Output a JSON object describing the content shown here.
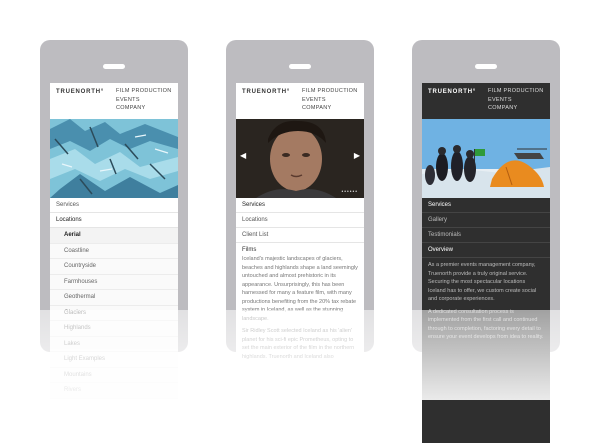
{
  "phones": [
    {
      "logo": "TRUENORTH°",
      "nav": [
        "FILM PRODUCTION",
        "EVENTS",
        "COMPANY"
      ],
      "menu": [
        {
          "label": "Services"
        },
        {
          "label": "Locations",
          "active": true
        }
      ],
      "submenu": [
        {
          "label": "Aerial",
          "active": true
        },
        {
          "label": "Coastline"
        },
        {
          "label": "Countryside"
        },
        {
          "label": "Farmhouses"
        },
        {
          "label": "Geothermal"
        },
        {
          "label": "Glaciers"
        },
        {
          "label": "Highlands"
        },
        {
          "label": "Lakes"
        },
        {
          "label": "Light Examples"
        },
        {
          "label": "Mountains"
        },
        {
          "label": "Rivers"
        }
      ]
    },
    {
      "logo": "TRUENORTH°",
      "nav": [
        "FILM PRODUCTION",
        "EVENTS",
        "COMPANY"
      ],
      "menu": [
        {
          "label": "Services",
          "active": true
        },
        {
          "label": "Locations"
        },
        {
          "label": "Client List"
        }
      ],
      "body_title": "Films",
      "body_paragraphs": [
        "Iceland's majestic landscapes of glaciers, beaches and highlands shape a land seemingly untouched and almost prehistoric in its appearance. Unsurprisingly, this has been harnessed for many a feature film, with many productions benefiting from the 20% tax rebate system in Iceland, as well as the stunning landscape.",
        "Sir Ridley Scott selected Iceland as his 'alien' planet for his sci-fi epic Prometheus, opting to set the main exterior of the film in the northern highlands. Truenorth and Iceland also"
      ]
    },
    {
      "logo": "TRUENORTH°",
      "nav": [
        "FILM PRODUCTION",
        "EVENTS",
        "COMPANY"
      ],
      "menu": [
        {
          "label": "Services",
          "active": true
        },
        {
          "label": "Gallery"
        },
        {
          "label": "Testimonials"
        }
      ],
      "body_title": "Overview",
      "body_paragraphs": [
        "As a premier events management company, Truenorth provide a truly original service. Securing the most spectacular locations Iceland has to offer, we custom create social and corporate experiences.",
        "A dedicated consultation process is implemented from the first call and continued through to completion, factoring every detail to ensure your event develops from idea to reality."
      ]
    }
  ]
}
